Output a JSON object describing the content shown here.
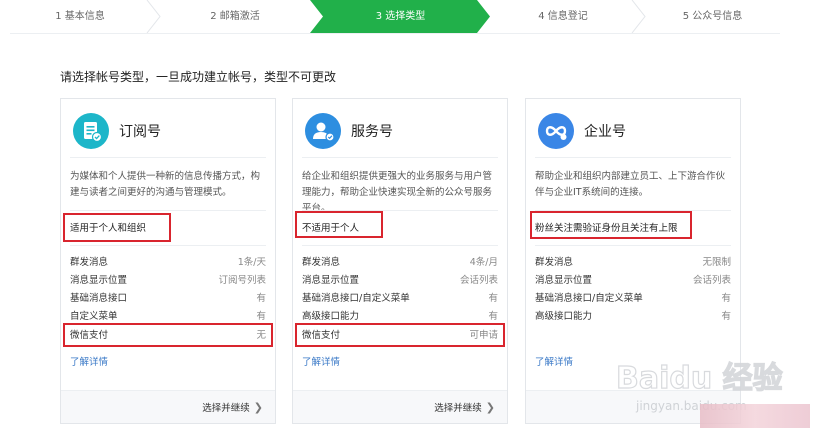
{
  "steps": [
    {
      "label": "1 基本信息"
    },
    {
      "label": "2 邮箱激活"
    },
    {
      "label": "3 选择类型"
    },
    {
      "label": "4 信息登记"
    },
    {
      "label": "5 公众号信息"
    }
  ],
  "active_step": 3,
  "colors": {
    "active_step": "#21b04a",
    "link": "#3a79c7",
    "highlight_box": "#d9252e"
  },
  "subtitle": "请选择帐号类型，一旦成功建立帐号，类型不可更改",
  "cards": [
    {
      "icon": "subscription-document-icon",
      "name": "订阅号",
      "desc": "为媒体和个人提供一种新的信息传播方式，构建与读者之间更好的沟通与管理模式。",
      "suitability": "适用于个人和组织",
      "features": [
        {
          "k": "群发消息",
          "v": "1条/天"
        },
        {
          "k": "消息显示位置",
          "v": "订阅号列表"
        },
        {
          "k": "基础消息接口",
          "v": "有"
        },
        {
          "k": "自定义菜单",
          "v": "有"
        },
        {
          "k": "微信支付",
          "v": "无"
        }
      ],
      "more": "了解详情",
      "continue": "选择并继续"
    },
    {
      "icon": "service-person-icon",
      "name": "服务号",
      "desc": "给企业和组织提供更强大的业务服务与用户管理能力，帮助企业快速实现全新的公众号服务平台。",
      "suitability": "不适用于个人",
      "features": [
        {
          "k": "群发消息",
          "v": "4条/月"
        },
        {
          "k": "消息显示位置",
          "v": "会话列表"
        },
        {
          "k": "基础消息接口/自定义菜单",
          "v": "有"
        },
        {
          "k": "高级接口能力",
          "v": "有"
        },
        {
          "k": "微信支付",
          "v": "可申请"
        }
      ],
      "more": "了解详情",
      "continue": "选择并继续"
    },
    {
      "icon": "enterprise-link-icon",
      "name": "企业号",
      "desc": "帮助企业和组织内部建立员工、上下游合作伙伴与企业IT系统间的连接。",
      "suitability": "粉丝关注需验证身份且关注有上限",
      "features": [
        {
          "k": "群发消息",
          "v": "无限制"
        },
        {
          "k": "消息显示位置",
          "v": "会话列表"
        },
        {
          "k": "基础消息接口/自定义菜单",
          "v": "有"
        },
        {
          "k": "高级接口能力",
          "v": "有"
        }
      ],
      "more": "了解详情",
      "continue": null
    }
  ],
  "watermark": {
    "line1": "Baidu 经验",
    "line2": "jingyan.baidu.com"
  }
}
